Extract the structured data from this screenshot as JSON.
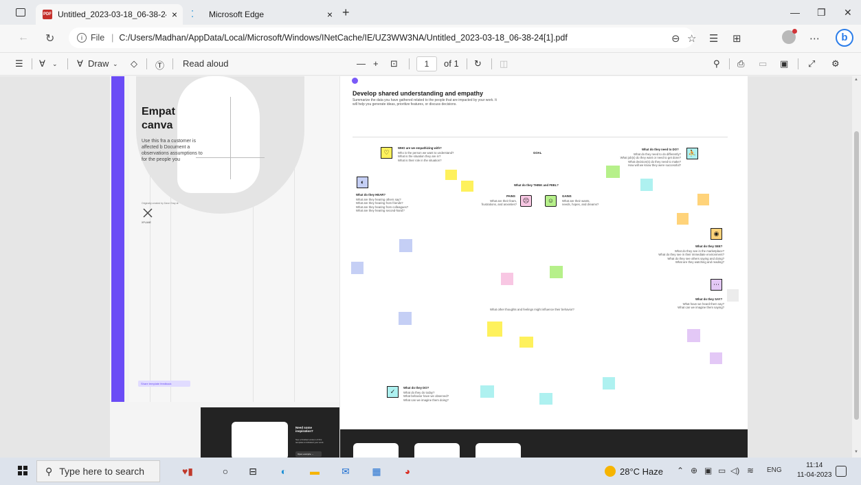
{
  "browser": {
    "tabs": [
      {
        "title": "Untitled_2023-03-18_06-38-24[1]",
        "close": "×"
      },
      {
        "title": "Microsoft Edge",
        "close": "×"
      }
    ],
    "new_tab": "+",
    "window_controls": {
      "minimize": "—",
      "restore": "❐",
      "close": "✕"
    },
    "address": {
      "scheme_label": "File",
      "url": "C:/Users/Madhan/AppData/Local/Microsoft/Windows/INetCache/IE/UZ3WW3NA/Untitled_2023-03-18_06-38-24[1].pdf"
    }
  },
  "pdf_toolbar": {
    "draw_label": "Draw",
    "read_aloud_label": "Read aloud",
    "zoom_out": "—",
    "zoom_in": "+",
    "page_number": "1",
    "page_total": "of 1"
  },
  "canvas": {
    "left_title_line1": "Empat",
    "left_title_line2": "canva",
    "left_body": "Use this fra a customer is affected b Document a observations assumptions to for the people you",
    "credit": "Originally created by Dave Gray at",
    "logo_text": "XPLANE",
    "feedback_button": "Share template feedback",
    "inspiration_title": "Need some inspiration?",
    "inspiration_sub": "See a finished version of this template to kickstart your work.",
    "open_example": "Open example →",
    "main_title": "Develop shared understanding and empathy",
    "main_sub": "Summarize the data you have gathered related to the people that are impacted by your work. It will help you generate ideas, prioritize features, or discuss decisions.",
    "who_title": "WHO are we empathizing with?",
    "who_lines": [
      "Who is the person we want to understand?",
      "What is the situation they are in?",
      "What is their role in the situation?"
    ],
    "goal": "GOAL",
    "need_title": "What do they need to DO?",
    "need_lines": [
      "What do they need to do differently?",
      "What job(s) do they want or need to get done?",
      "What decision(s) do they need to make?",
      "How will we know they were successful?"
    ],
    "think_title": "What do they THINK and FEEL?",
    "pains_title": "PAINS",
    "pains_lines": [
      "What are their fears,",
      "frustrations, and anxieties?"
    ],
    "gains_title": "GAINS",
    "gains_lines": [
      "What are their wants,",
      "needs, hopes, and dreams?"
    ],
    "hear_title": "What do they HEAR?",
    "hear_lines": [
      "What are they hearing others say?",
      "What are they hearing from friends?",
      "What are they hearing from colleagues?",
      "What are they hearing second-hand?"
    ],
    "see_title": "What do they SEE?",
    "see_lines": [
      "What do they see in the marketplace?",
      "What do they see in their immediate environment?",
      "What do they see others saying and doing?",
      "What are they watching and reading?"
    ],
    "say_title": "What do they SAY?",
    "say_lines": [
      "What have we heard them say?",
      "What can we imagine them saying?"
    ],
    "influence": "What other thoughts and feelings might influence their behavior?",
    "do_title": "What do they DO?",
    "do_lines": [
      "What do they do today?",
      "What behavior have we observed?",
      "What can we imagine them doing?"
    ]
  },
  "taskbar": {
    "search_placeholder": "Type here to search",
    "weather": "28°C  Haze",
    "language": "ENG",
    "time": "11:14",
    "date": "11-04-2023"
  },
  "colors": {
    "accent": "#6b4cf6",
    "yellow": "#fef15c",
    "blue": "#c5cff5",
    "green": "#b6f08a",
    "pink": "#f8c7e3",
    "cyan": "#aef1f0",
    "orange": "#ffd37a",
    "purple": "#e3c8f6"
  }
}
